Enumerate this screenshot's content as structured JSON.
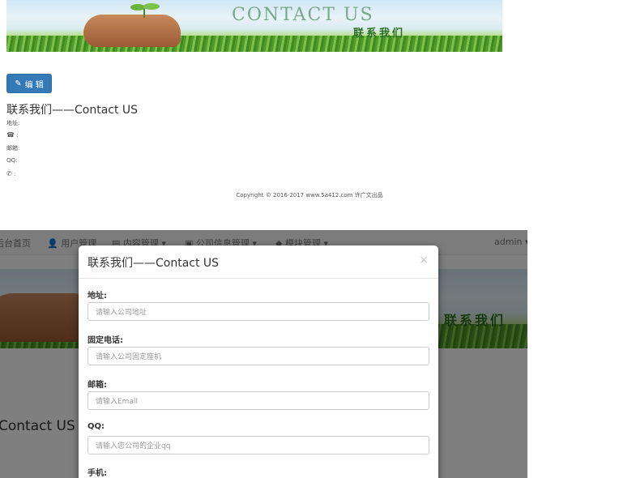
{
  "banner": {
    "title_en": "CONTACT US",
    "title_cn": "联系我们"
  },
  "edit_button": {
    "label": "编 辑",
    "icon": "pencil-icon"
  },
  "contact": {
    "heading": "联系我们——Contact US",
    "lines": [
      {
        "label": "地址",
        "sep": ":"
      },
      {
        "label": "☎",
        "sep": ":"
      },
      {
        "label": "邮箱",
        "sep": ":"
      },
      {
        "label": "QQ",
        "sep": ":"
      },
      {
        "label": "✆",
        "sep": ":"
      }
    ]
  },
  "footer": {
    "copyright": "Copyright © 2016-2017 www.5a412.com 许广文出品"
  },
  "admin": {
    "nav": {
      "home": "后台首页",
      "users": "用户管理",
      "content": "内容管理",
      "company": "公司信息管理",
      "modules": "模块管理",
      "user": "admin"
    },
    "banner_cn": "联系我们",
    "bg_heading": "Contact US"
  },
  "modal": {
    "title": "联系我们——Contact US",
    "close": "×",
    "fields": [
      {
        "label": "地址:",
        "placeholder": "请输入公司地址"
      },
      {
        "label": "固定电话:",
        "placeholder": "请输入公司固定座机"
      },
      {
        "label": "邮箱:",
        "placeholder": "请输入Email"
      },
      {
        "label": "QQ:",
        "placeholder": "请输入您公司的企业qq"
      },
      {
        "label": "手机:",
        "placeholder": ""
      }
    ]
  },
  "colors": {
    "primary": "#337ab7",
    "navbar_bg": "#f8f8f8",
    "overlay": "rgba(0,0,0,0.5)"
  }
}
